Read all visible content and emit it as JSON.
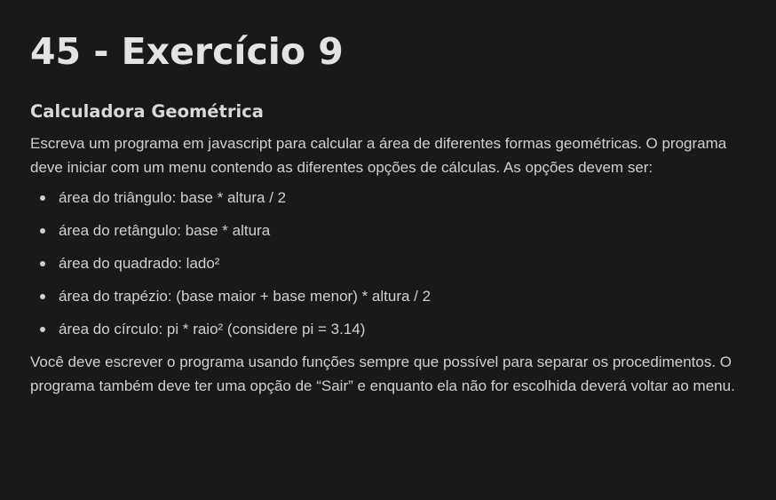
{
  "page": {
    "title": "45 - Exercício 9",
    "section_title": "Calculadora Geométrica",
    "intro": "Escreva um programa em javascript para calcular a área de diferentes formas geométricas. O programa deve iniciar com um menu contendo as diferentes opções de cálculas. As opções devem ser:",
    "options": [
      "área do triângulo: base * altura / 2",
      "área do retângulo: base * altura",
      "área do quadrado: lado²",
      "área do trapézio: (base maior + base menor) * altura / 2",
      "área do círculo: pi * raio² (considere pi = 3.14)"
    ],
    "outro": "Você deve escrever o programa usando funções sempre que possível para separar os procedimentos. O programa também deve ter uma opção de “Sair” e enquanto ela não for escolhida deverá voltar ao menu."
  },
  "colors": {
    "background": "#191919",
    "text": "#d0d0d0",
    "heading": "#e3e3e3"
  }
}
